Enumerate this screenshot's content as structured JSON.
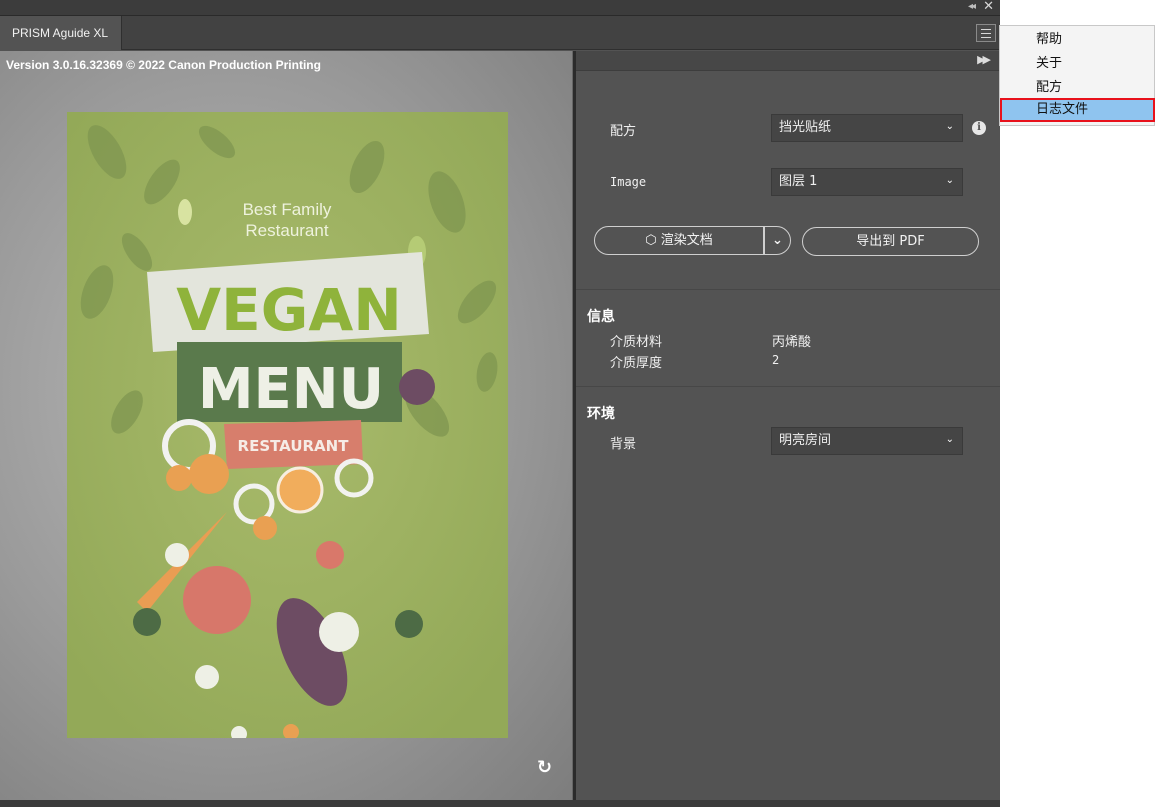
{
  "window": {
    "tab_title": "PRISM Aguide XL"
  },
  "preview": {
    "version_text": "Version 3.0.16.32369 © 2022 Canon Production Printing",
    "poster": {
      "line1": "Best Family",
      "line2": "Restaurant",
      "big1": "VEGAN",
      "big2": "MENU",
      "tag": "RESTAURANT"
    }
  },
  "settings": {
    "recipe_label": "配方",
    "recipe_value": "挡光贴纸",
    "image_label": "Image",
    "image_value": "图层 1",
    "render_button": "渲染文档",
    "export_button": "导出到 PDF"
  },
  "info": {
    "title": "信息",
    "material_label": "介质材料",
    "material_value": "丙烯酸",
    "thickness_label": "介质厚度",
    "thickness_value": "2"
  },
  "environment": {
    "title": "环境",
    "background_label": "背景",
    "background_value": "明亮房间"
  },
  "context_menu": {
    "items": [
      "帮助",
      "关于",
      "配方",
      "日志文件"
    ],
    "selected_index": 3
  },
  "colors": {
    "panel_bg": "#535353",
    "poster_bg": "#9db160",
    "highlight": "#8fc4ef",
    "highlight_border": "#e8111b"
  }
}
